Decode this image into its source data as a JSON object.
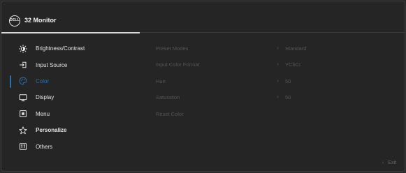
{
  "header": {
    "logo": "DELL",
    "title": "32 Monitor"
  },
  "menu": [
    {
      "label": "Brightness/Contrast",
      "icon": "brightness-icon"
    },
    {
      "label": "Input Source",
      "icon": "input-source-icon"
    },
    {
      "label": "Color",
      "icon": "color-palette-icon",
      "active": true
    },
    {
      "label": "Display",
      "icon": "display-icon"
    },
    {
      "label": "Menu",
      "icon": "menu-icon"
    },
    {
      "label": "Personalize",
      "icon": "star-icon",
      "bold": true
    },
    {
      "label": "Others",
      "icon": "others-icon"
    }
  ],
  "submenu": [
    {
      "label": "Preset Modes",
      "value": "Standard"
    },
    {
      "label": "Input Color Format",
      "value": "YCbCr"
    },
    {
      "label": "Hue",
      "value": "50"
    },
    {
      "label": "Saturation",
      "value": "50"
    },
    {
      "label": "Reset Color",
      "value": ""
    }
  ],
  "footer": {
    "exit_label": "Exit"
  },
  "colors": {
    "accent": "#2f6ea8",
    "background": "#252525",
    "text": "#e6e6e6",
    "disabled": "#555555"
  }
}
